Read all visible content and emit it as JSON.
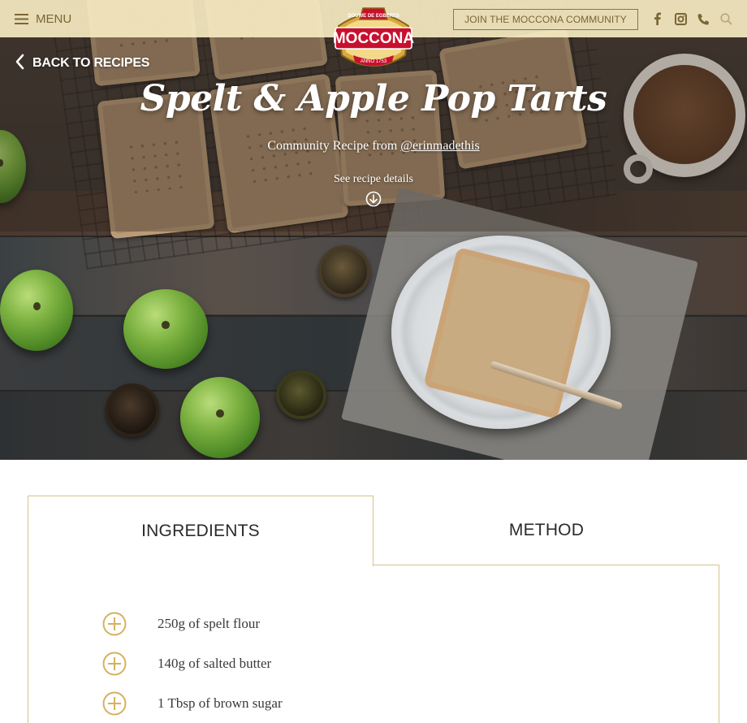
{
  "header": {
    "menu_label": "MENU",
    "join_label": "JOIN THE MOCCONA COMMUNITY",
    "social_icons": [
      "facebook-icon",
      "instagram-icon",
      "phone-icon",
      "search-icon"
    ],
    "logo": {
      "brand": "MOCCONA",
      "top_text": "DOUWE DE EGBERTS",
      "bottom_text": "ANNO 1753"
    }
  },
  "hero": {
    "back_label": "BACK TO RECIPES",
    "title": "Spelt & Apple Pop Tarts",
    "community_prefix": "Community Recipe from ",
    "community_handle": "@erinmadethis",
    "see_details_label": "See recipe details"
  },
  "tabs": {
    "ingredients_label": "INGREDIENTS",
    "method_label": "METHOD",
    "active": "INGREDIENTS"
  },
  "ingredients": [
    "250g of spelt flour",
    "140g of salted butter",
    "1 Tbsp of brown sugar"
  ],
  "colors": {
    "gold": "#d4b15f",
    "topbar": "#faeec4",
    "topbar_text": "#7a6636",
    "tab_border": "#d7c28c",
    "logo_red": "#c8102e"
  }
}
